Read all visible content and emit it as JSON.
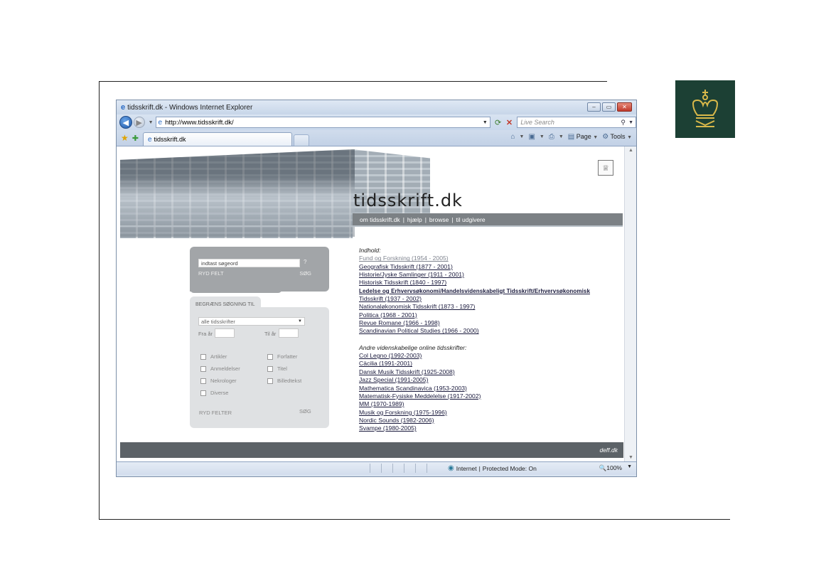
{
  "browser": {
    "window_title": "tidsskrift.dk - Windows Internet Explorer",
    "url": "http://www.tidsskrift.dk/",
    "search_placeholder": "Live Search",
    "tab_title": "tidsskrift.dk",
    "cmd": {
      "page": "Page",
      "tools": "Tools"
    },
    "status": {
      "zone": "Internet",
      "mode": "Protected Mode: On",
      "zoom": "100%"
    }
  },
  "site": {
    "brand": "tidsskrift.dk",
    "nav": [
      "om tidsskrift.dk",
      "hjælp",
      "browse",
      "til udgivere"
    ],
    "search": {
      "placeholder": "indtast søgeord",
      "help": "?",
      "clear": "RYD FELT",
      "submit": "SØG"
    },
    "filter": {
      "title": "BEGRÆNS SØGNING TIL",
      "select_value": "alle tidsskrifter",
      "from_label": "Fra år",
      "to_label": "Til år",
      "checkboxes": [
        "Artikler",
        "Anmeldelser",
        "Nekrologer",
        "Diverse",
        "Forfatter",
        "Titel",
        "Billedtekst"
      ],
      "clear": "RYD FELTER",
      "submit": "SØG"
    },
    "content": {
      "heading1": "Indhold:",
      "journals1": [
        "Fund og Forskning (1954 - 2005)",
        "Geografisk Tidsskrift (1877 - 2001)",
        "Historie/Jyske Samlinger (1911 - 2001)",
        "Historisk Tidsskrift (1840 - 1997)",
        "Ledelse og Erhvervsøkonomi/Handelsvidenskabeligt Tidsskrift/Erhvervsøkonomisk",
        "Tidsskrift (1937 - 2002)",
        "Nationaløkonomisk Tidsskrift (1873 - 1997)",
        "Politica (1968 - 2001)",
        "Revue Romane (1966 - 1998)",
        "Scandinavian Political Studies (1966 - 2000)"
      ],
      "heading2": "Andre videnskabelige online tidsskrifter:",
      "journals2": [
        "Col Legno (1992-2003)",
        "Cäcilia (1991-2001)",
        "Dansk Musik Tidsskrift (1925-2008)",
        "Jazz Special (1991-2005)",
        "Mathematica Scandinavica (1953-2003)",
        "Matematisk-Fysiske Meddelelse (1917-2002)",
        "MM (1970-1989)",
        "Musik og Forskning (1975-1996)",
        "Nordic Sounds (1982-2006)",
        "Svampe (1980-2005)"
      ]
    },
    "footer": "deff.dk"
  },
  "colors": {
    "crown_bg": "#1c4034",
    "crown_gold": "#d8b84a"
  }
}
